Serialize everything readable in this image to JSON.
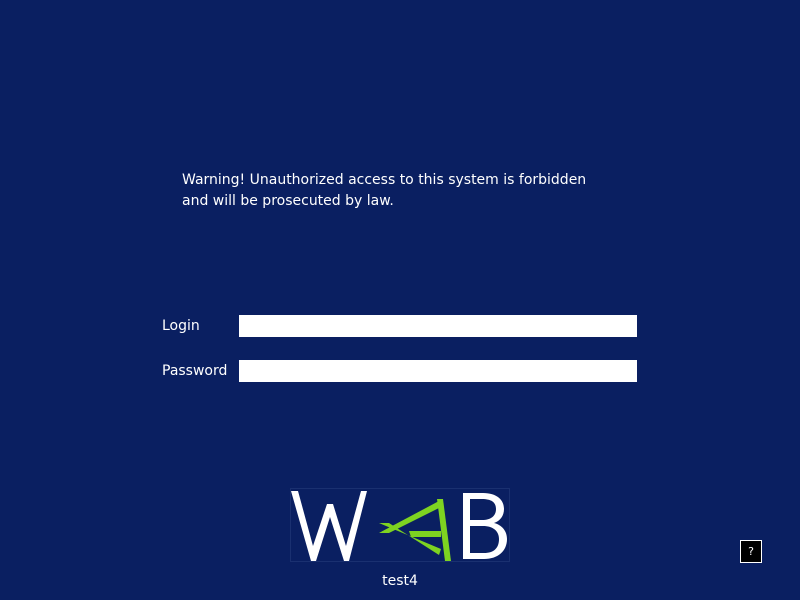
{
  "warning": {
    "line1": "Warning! Unauthorized access to this system is forbidden",
    "line2": "and will be prosecuted by law."
  },
  "form": {
    "login_label": "Login",
    "login_value": "",
    "password_label": "Password",
    "password_value": ""
  },
  "logo": {
    "text": "WAB",
    "accent_color": "#7ed321",
    "letter_color": "#ffffff"
  },
  "target": {
    "name": "test4"
  },
  "help": {
    "label": "?"
  },
  "colors": {
    "background": "#0a1f61",
    "text": "#ffffff",
    "input_background": "#ffffff"
  }
}
